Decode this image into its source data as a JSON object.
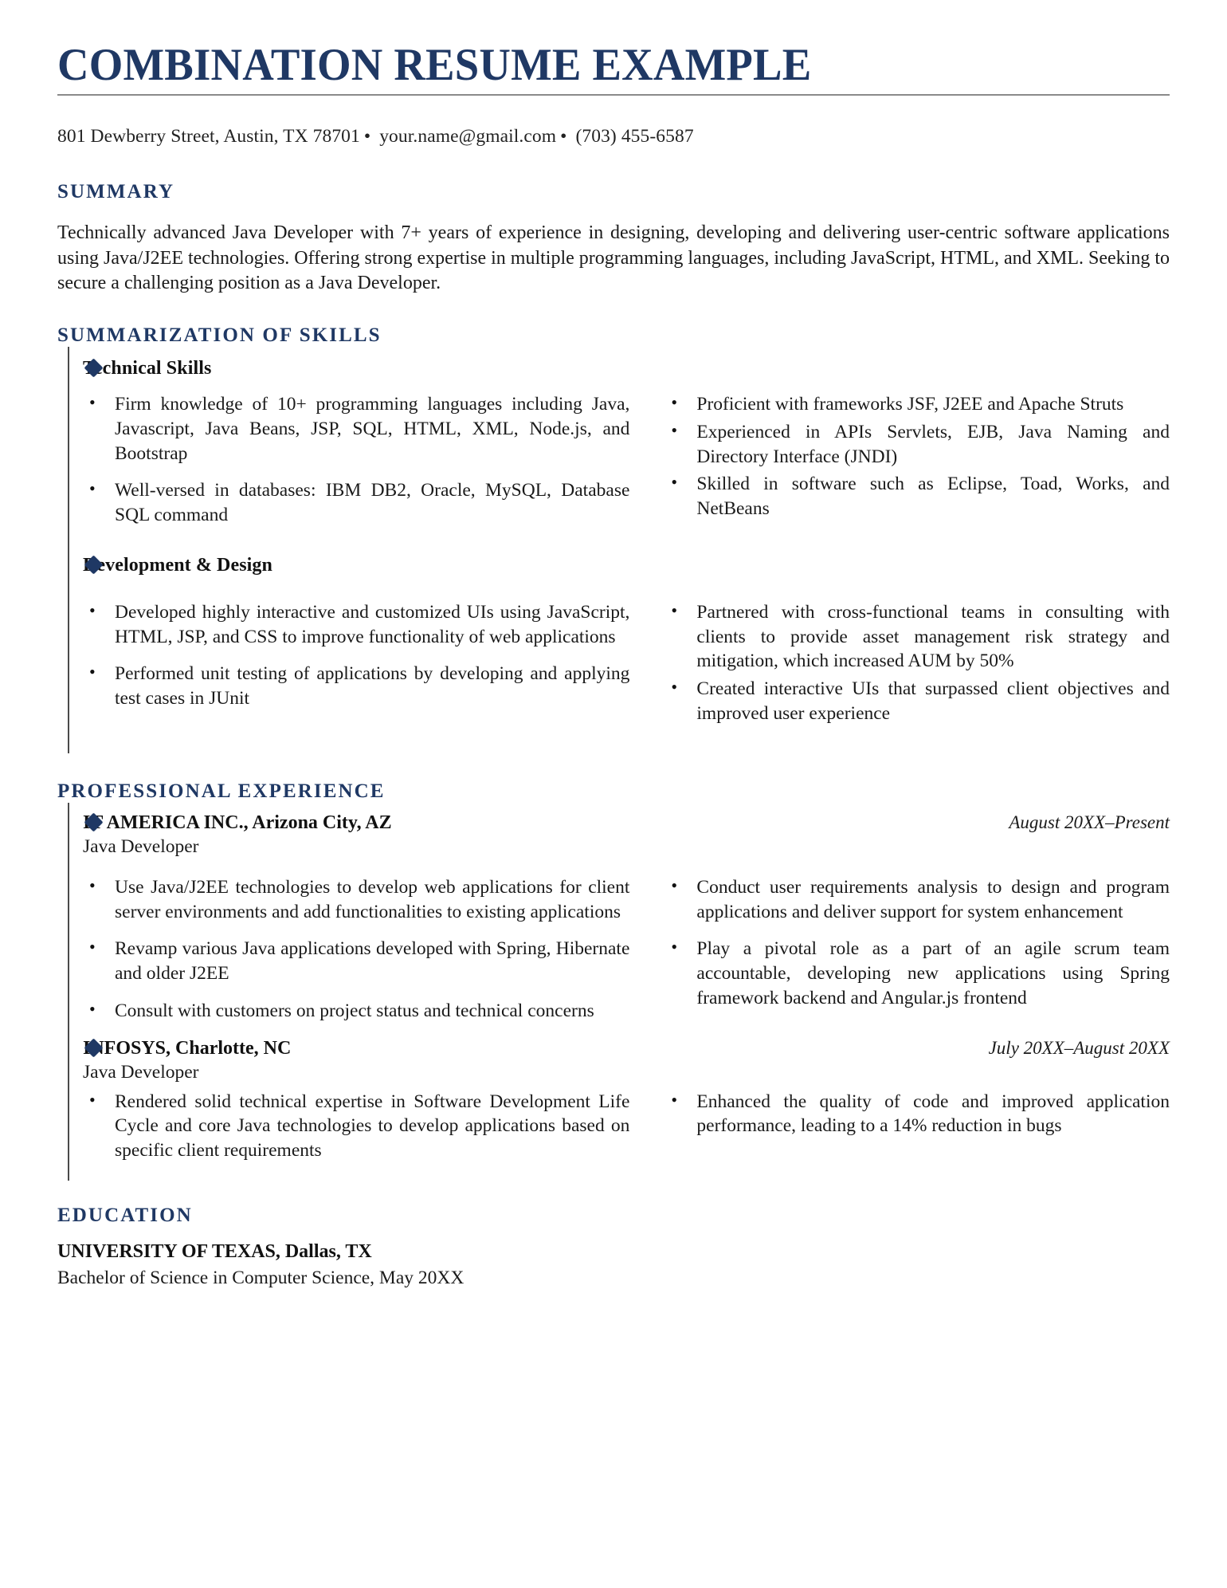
{
  "header": {
    "title": "COMBINATION RESUME EXAMPLE",
    "contact": {
      "address": "801 Dewberry Street, Austin, TX 78701",
      "separator1": "•",
      "email": "your.name@gmail.com",
      "separator2": "•",
      "phone": "(703) 455-6587"
    }
  },
  "sections": {
    "summary": {
      "heading": "SUMMARY",
      "text": "Technically advanced Java Developer with 7+ years of experience in designing, developing and delivering user-centric software applications using Java/J2EE technologies. Offering strong expertise in multiple programming languages, including JavaScript, HTML, and XML. Seeking to secure a challenging position as a Java Developer."
    },
    "skills": {
      "heading": "SUMMARIZATION OF SKILLS",
      "groups": [
        {
          "name": "Technical Skills",
          "left_bullets": [
            "Firm knowledge of 10+ programming languages including Java, Javascript, Java Beans, JSP, SQL, HTML, XML, Node.js, and Bootstrap",
            "Well-versed in databases: IBM DB2, Oracle, MySQL, Database SQL command"
          ],
          "right_bullets": [
            "Proficient with frameworks JSF, J2EE and Apache Struts",
            "Experienced in APIs Servlets, EJB, Java Naming and Directory Interface (JNDI)",
            "Skilled in software such as Eclipse, Toad, Works, and NetBeans"
          ]
        },
        {
          "name": "Development & Design",
          "left_bullets": [
            "Developed highly interactive and customized UIs using JavaScript, HTML, JSP, and CSS to improve functionality of web applications",
            "Performed unit testing of applications by developing and applying test cases in JUnit"
          ],
          "right_bullets": [
            "Partnered with cross-functional teams in consulting with clients to provide asset management risk strategy and mitigation, which increased AUM by 50%",
            "Created interactive UIs that surpassed client objectives and improved user experience"
          ]
        }
      ]
    },
    "experience": {
      "heading": "PROFESSIONAL EXPERIENCE",
      "jobs": [
        {
          "company": "IT AMERICA INC., Arizona City, AZ",
          "dates": "August 20XX–Present",
          "role": "Java Developer",
          "left_bullets": [
            "Use Java/J2EE technologies to develop web applications for client server environments and add functionalities to existing applications",
            "Revamp various Java applications developed with Spring, Hibernate and older J2EE",
            "Consult with customers on project status and technical concerns"
          ],
          "right_bullets": [
            "Conduct user requirements analysis to design and program applications and deliver support for system enhancement",
            "Play a pivotal role as a part of an agile scrum team accountable, developing new applications using Spring framework backend and Angular.js frontend"
          ]
        },
        {
          "company": "INFOSYS, Charlotte, NC",
          "dates": "July 20XX–August 20XX",
          "role": "Java Developer",
          "left_bullets": [
            "Rendered solid technical expertise in Software Development Life Cycle and core Java technologies to develop applications based on specific client requirements"
          ],
          "right_bullets": [
            "Enhanced the quality of code and improved application performance, leading to a 14% reduction in bugs"
          ]
        }
      ]
    },
    "education": {
      "heading": "EDUCATION",
      "school": "UNIVERSITY OF TEXAS, Dallas, TX",
      "degree": "Bachelor of Science in Computer Science, May 20XX"
    }
  },
  "colors": {
    "accent_navy": "#1f3864",
    "body_text": "#1a1a1a",
    "rule_gray": "#8a8a8a"
  }
}
